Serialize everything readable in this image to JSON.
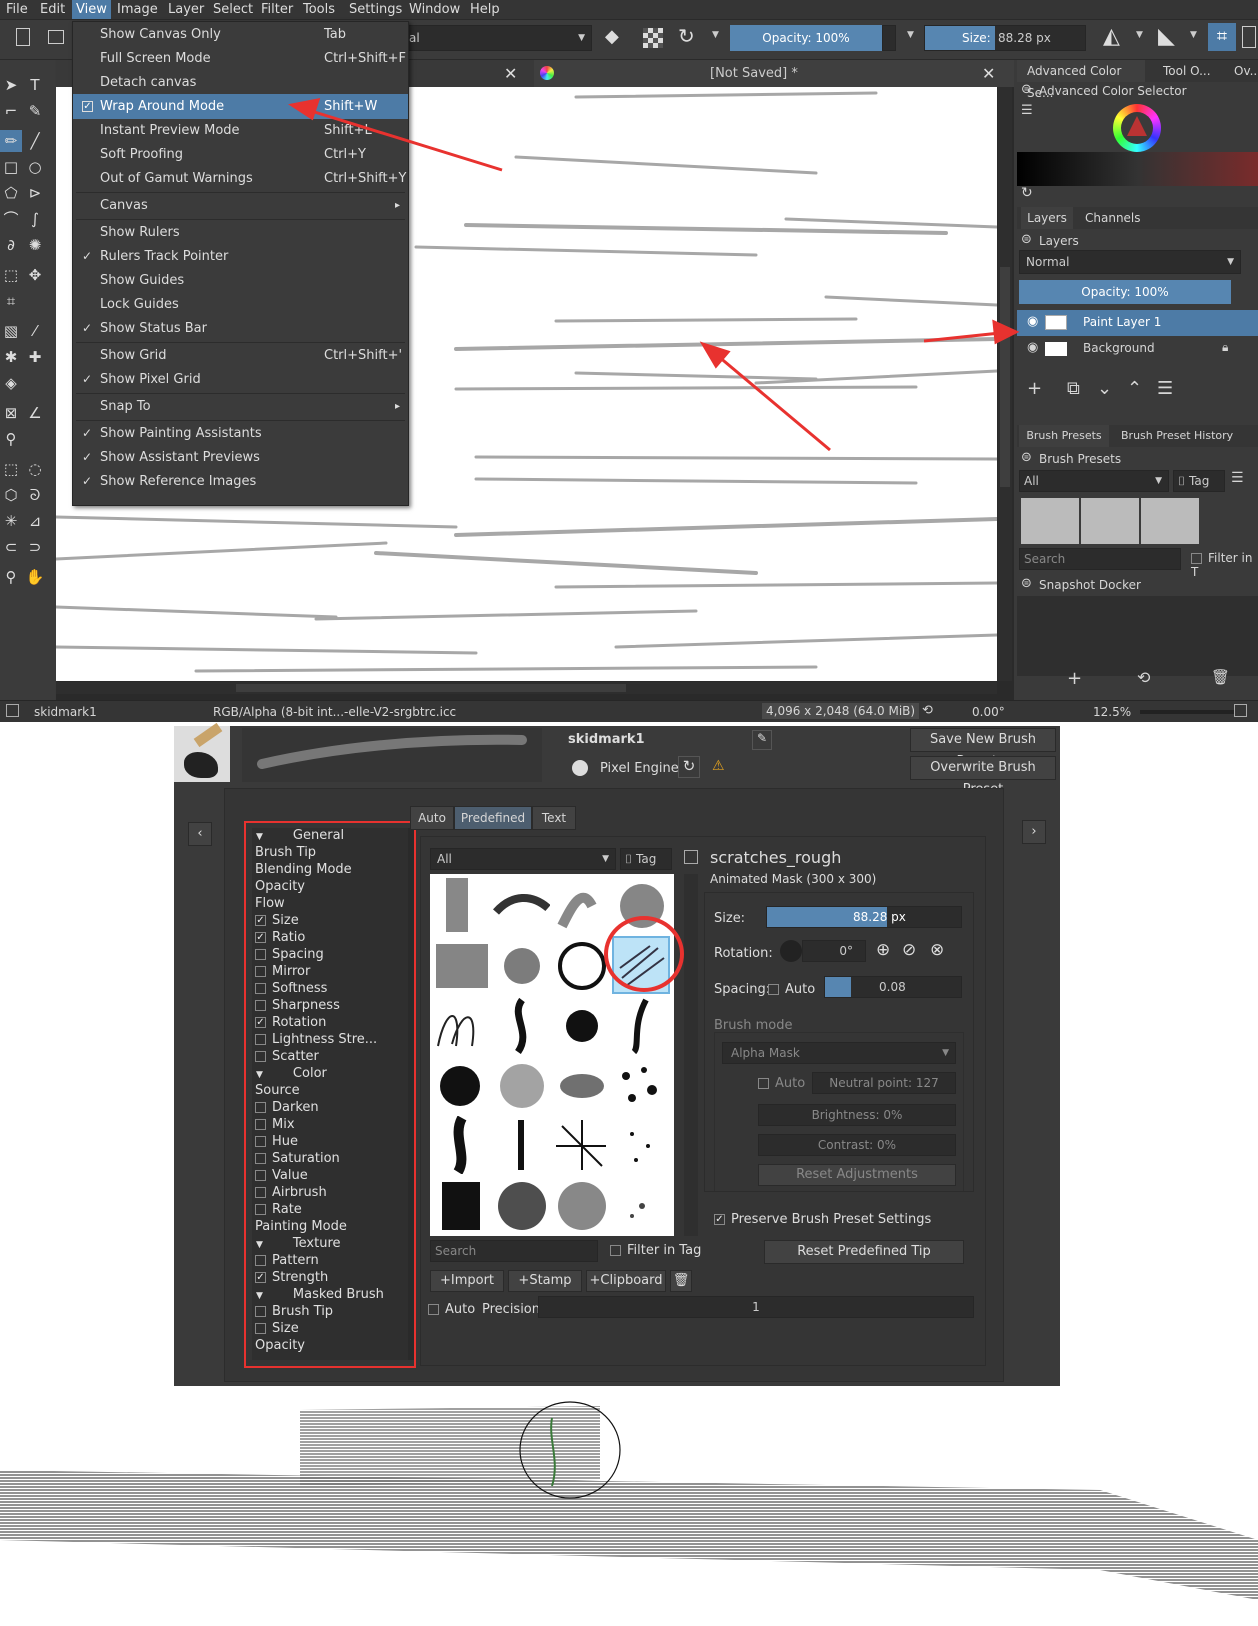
{
  "menubar": {
    "items": [
      "File",
      "Edit",
      "View",
      "Image",
      "Layer",
      "Select",
      "Filter",
      "Tools",
      "Settings",
      "Window",
      "Help"
    ]
  },
  "toolbar": {
    "blend_field": "al",
    "opacity": "Opacity: 100%",
    "size_label": "Size:",
    "size_value": "88.28 px"
  },
  "tabs": {
    "doc_title": "[Not Saved]  *",
    "close": "✕"
  },
  "view_menu": {
    "items": [
      {
        "label": "Show Canvas Only",
        "shortcut": "Tab",
        "check": ""
      },
      {
        "label": "Full Screen Mode",
        "shortcut": "Ctrl+Shift+F",
        "check": ""
      },
      {
        "label": "Detach canvas",
        "shortcut": "",
        "check": ""
      },
      {
        "label": "Wrap Around Mode",
        "shortcut": "Shift+W",
        "check": "✓"
      },
      {
        "label": "Instant Preview Mode",
        "shortcut": "Shift+L",
        "check": ""
      },
      {
        "label": "Soft Proofing",
        "shortcut": "Ctrl+Y",
        "check": ""
      },
      {
        "label": "Out of Gamut Warnings",
        "shortcut": "Ctrl+Shift+Y",
        "check": ""
      },
      {
        "label": "Canvas",
        "shortcut": "",
        "check": ""
      },
      {
        "label": "Show Rulers",
        "shortcut": "",
        "check": ""
      },
      {
        "label": "Rulers Track Pointer",
        "shortcut": "",
        "check": "✓"
      },
      {
        "label": "Show Guides",
        "shortcut": "",
        "check": ""
      },
      {
        "label": "Lock Guides",
        "shortcut": "",
        "check": ""
      },
      {
        "label": "Show Status Bar",
        "shortcut": "",
        "check": "✓"
      },
      {
        "label": "Show Grid",
        "shortcut": "Ctrl+Shift+'",
        "check": ""
      },
      {
        "label": "Show Pixel Grid",
        "shortcut": "",
        "check": "✓"
      },
      {
        "label": "Snap To",
        "shortcut": "",
        "check": ""
      },
      {
        "label": "Show Painting Assistants",
        "shortcut": "",
        "check": "✓"
      },
      {
        "label": "Show Assistant Previews",
        "shortcut": "",
        "check": "✓"
      },
      {
        "label": "Show Reference Images",
        "shortcut": "",
        "check": "✓"
      }
    ]
  },
  "dock": {
    "color_tabs": [
      "Advanced Color Se...",
      "Tool O...",
      "Ov..."
    ],
    "color_title": "Advanced Color Selector",
    "layer_tabs": [
      "Layers",
      "Channels"
    ],
    "layers_title": "Layers",
    "blend": "Normal",
    "opacity": "Opacity:  100%",
    "layers": [
      "Paint Layer 1",
      "Background"
    ],
    "brush_tabs": [
      "Brush Presets",
      "Brush Preset History"
    ],
    "brush_title": "Brush Presets",
    "brush_filter": "All",
    "tag": "Tag",
    "search": "Search",
    "filter_in_tag": "Filter in T",
    "snapshot": "Snapshot Docker"
  },
  "status": {
    "name": "skidmark1",
    "profile": "RGB/Alpha (8-bit int...-elle-V2-srgbtrc.icc",
    "dims": "4,096 x 2,048 (64.0 MiB)",
    "angle": "0.00°",
    "zoom": "12.5%"
  },
  "editor": {
    "preset_name": "skidmark1",
    "engine": "Pixel Engine",
    "save_new": "Save New Brush Preset...",
    "overwrite": "Overwrite Brush Preset",
    "options": [
      {
        "label": "General",
        "type": "header"
      },
      {
        "label": "Brush Tip",
        "type": "plain"
      },
      {
        "label": "Blending Mode",
        "type": "plain"
      },
      {
        "label": "Opacity",
        "type": "plain"
      },
      {
        "label": "Flow",
        "type": "plain"
      },
      {
        "label": "Size",
        "type": "checked"
      },
      {
        "label": "Ratio",
        "type": "checked"
      },
      {
        "label": "Spacing",
        "type": "unchecked"
      },
      {
        "label": "Mirror",
        "type": "unchecked"
      },
      {
        "label": "Softness",
        "type": "unchecked"
      },
      {
        "label": "Sharpness",
        "type": "unchecked"
      },
      {
        "label": "Rotation",
        "type": "checked"
      },
      {
        "label": "Lightness Stre...",
        "type": "unchecked"
      },
      {
        "label": "Scatter",
        "type": "unchecked"
      },
      {
        "label": "Color",
        "type": "header"
      },
      {
        "label": "Source",
        "type": "plain"
      },
      {
        "label": "Darken",
        "type": "unchecked"
      },
      {
        "label": "Mix",
        "type": "unchecked"
      },
      {
        "label": "Hue",
        "type": "unchecked"
      },
      {
        "label": "Saturation",
        "type": "unchecked"
      },
      {
        "label": "Value",
        "type": "unchecked"
      },
      {
        "label": "Airbrush",
        "type": "unchecked"
      },
      {
        "label": "Rate",
        "type": "unchecked"
      },
      {
        "label": "Painting Mode",
        "type": "plain"
      },
      {
        "label": "Texture",
        "type": "header"
      },
      {
        "label": "Pattern",
        "type": "unchecked"
      },
      {
        "label": "Strength",
        "type": "checked"
      },
      {
        "label": "Masked Brush",
        "type": "header"
      },
      {
        "label": "Brush Tip",
        "type": "unchecked"
      },
      {
        "label": "Size",
        "type": "unchecked"
      },
      {
        "label": "Opacity",
        "type": "plain"
      }
    ],
    "tip_tabs": [
      "Auto",
      "Predefined",
      "Text"
    ],
    "filter": "All",
    "tag": "Tag",
    "tip_name": "scratches_rough",
    "tip_desc": "Animated Mask (300 x 300)",
    "size_label": "Size:",
    "size_value": "88.28 px",
    "rotation_label": "Rotation:",
    "rotation_value": "0°",
    "spacing_label": "Spacing:",
    "spacing_auto": "Auto",
    "spacing_value": "0.08",
    "brush_mode": "Brush mode",
    "alpha_mask": "Alpha Mask",
    "auto": "Auto",
    "neutral": "Neutral point: 127",
    "brightness": "Brightness: 0%",
    "contrast": "Contrast: 0%",
    "reset_adj": "Reset Adjustments",
    "preserve": "Preserve Brush Preset Settings",
    "reset_tip": "Reset Predefined Tip",
    "search": "Search",
    "filter_in_tag": "Filter in Tag",
    "import": "Import",
    "stamp": "Stamp",
    "clipboard": "Clipboard",
    "precision_auto": "Auto",
    "precision_label": "Precision:",
    "precision_value": "1"
  }
}
